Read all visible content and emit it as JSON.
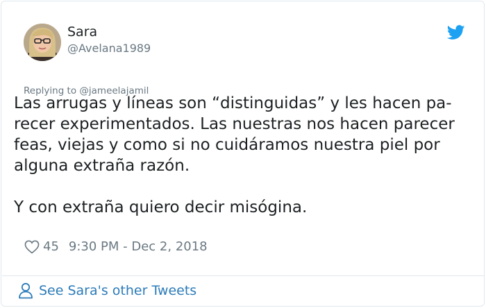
{
  "author": {
    "name": "Sara",
    "handle": "@Avelana1989",
    "avatar_icon": "profile-photo"
  },
  "reply_to": "Replying to @jameelajamil",
  "tweet": {
    "paragraph_1": "Las arrugas y líneas son “distinguidas” y les hacen pa-\nrecer experimentados. Las nuestras nos hacen parecer\nfeas, viejas y como si no cuidáramos nuestra piel por\nalguna extraña razón.",
    "paragraph_2": "Y con extraña quiero decir misógina."
  },
  "meta": {
    "likes": "45",
    "timestamp": "9:30 PM - Dec 2, 2018"
  },
  "footer": {
    "link_label": "See Sara's other Tweets"
  },
  "colors": {
    "twitter_blue": "#1da1f2",
    "link_blue": "#2b7bb9",
    "muted_gray": "#697882"
  }
}
